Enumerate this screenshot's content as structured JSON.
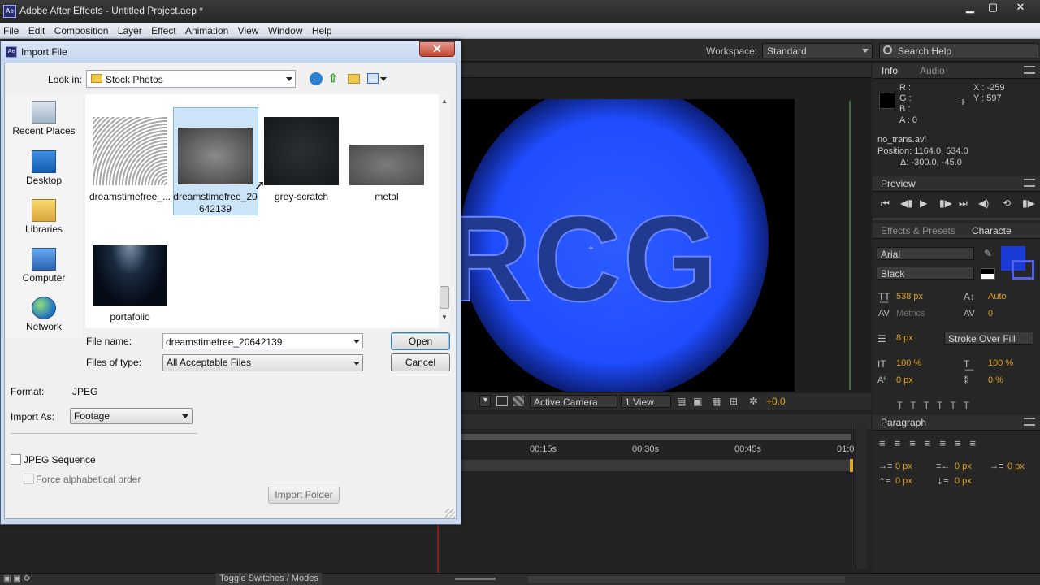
{
  "window": {
    "app_icon": "Ae",
    "title": "Adobe After Effects - Untitled Project.aep *"
  },
  "menu": [
    "File",
    "Edit",
    "Composition",
    "Layer",
    "Effect",
    "Animation",
    "View",
    "Window",
    "Help"
  ],
  "workspace": {
    "label": "Workspace:",
    "value": "Standard"
  },
  "search": {
    "placeholder": "Search Help"
  },
  "composition": {
    "text": "RCG",
    "toolbar": {
      "camera": "Active Camera",
      "view": "1 View",
      "offset": "+0.0"
    }
  },
  "timeline": {
    "ticks": [
      "00:15s",
      "00:30s",
      "00:45s",
      "01:0"
    ]
  },
  "status": {
    "toggle": "Toggle Switches / Modes"
  },
  "info": {
    "tabs": [
      "Info",
      "Audio"
    ],
    "r": "R :",
    "g": "G :",
    "b": "B :",
    "a": "A : 0",
    "x": "X : -259",
    "y": "Y : 597",
    "file": "no_trans.avi",
    "position": "Position: 1164.0, 534.0",
    "delta": "Δ: -300.0, -45.0"
  },
  "preview": {
    "tab": "Preview"
  },
  "character": {
    "tabs": [
      "Effects & Presets",
      "Characte"
    ],
    "font": "Arial",
    "style": "Black",
    "size": "538 px",
    "leading": "Auto",
    "kerning": "Metrics",
    "tracking": "0",
    "stroke_width": "8 px",
    "stroke_mode": "Stroke Over Fill",
    "vscale": "100 %",
    "hscale": "100 %",
    "baseline": "0 px",
    "tsume": "0 %",
    "fill_color": "#1a3bd6",
    "stroke_color": "#4f5df0"
  },
  "paragraph": {
    "tab": "Paragraph",
    "indent_left": "0 px",
    "indent_right": "0 px",
    "indent_first": "0 px",
    "space_before": "0 px",
    "space_after": "0 px"
  },
  "dialog": {
    "icon": "Ae",
    "title": "Import File",
    "close": "✕",
    "look_in_label": "Look in:",
    "look_in_value": "Stock Photos",
    "places": [
      "Recent Places",
      "Desktop",
      "Libraries",
      "Computer",
      "Network"
    ],
    "files": [
      {
        "name": "dreamstimefree_...",
        "selected": false
      },
      {
        "name": "dreamstimefree_20642139",
        "line1": "dreamstimefree_20",
        "line2": "642139",
        "selected": true
      },
      {
        "name": "grey-scratch",
        "selected": false
      },
      {
        "name": "metal",
        "selected": false
      },
      {
        "name": "portafolio",
        "selected": false
      }
    ],
    "file_name_label": "File name:",
    "file_name_value": "dreamstimefree_20642139",
    "file_type_label": "Files of type:",
    "file_type_value": "All Acceptable Files",
    "open_button": "Open",
    "cancel_button": "Cancel",
    "format_label": "Format:",
    "format_value": "JPEG",
    "import_as_label": "Import As:",
    "import_as_value": "Footage",
    "jpeg_sequence": "JPEG Sequence",
    "force_alpha": "Force alphabetical order",
    "import_folder": "Import Folder"
  }
}
